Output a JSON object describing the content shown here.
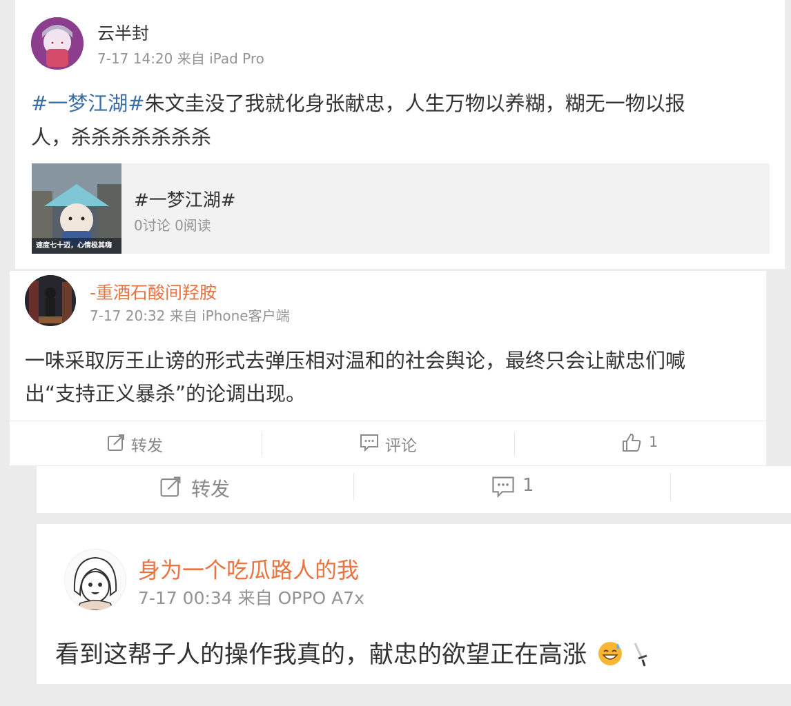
{
  "post1": {
    "username": "云半封",
    "meta": "7-17 14:20 来自 iPad Pro",
    "hashtag": "#一梦江湖#",
    "text_line1_rest": "朱文圭没了我就化身张献忠，人生万物以养糊，糊无一物以报",
    "text_line2": "人，杀杀杀杀杀杀杀",
    "topic_card": {
      "title": "#一梦江湖#",
      "stats": "0讨论 0阅读",
      "thumb_caption": "速度七十迈，心情极其嗨"
    }
  },
  "post2": {
    "username": "-重酒石酸间羟胺",
    "meta": "7-17 20:32 来自 iPhone客户端",
    "text_line1": "一味采取厉王止谤的形式去弹压相对温和的社会舆论，最终只会让献忠们喊",
    "text_line2": "出“支持正义暴杀”的论调出现。",
    "actions": {
      "repost": "转发",
      "comment": "评论",
      "like_count": "1"
    }
  },
  "action_bar2": {
    "repost": "转发",
    "comment_count": "1"
  },
  "post3": {
    "username": "身为一个吃瓜路人的我",
    "meta": "7-17 00:34 来自 OPPO A7x",
    "text": "看到这帮子人的操作我真的，献忠的欲望正在高涨"
  },
  "colors": {
    "hashtag_blue": "#3a6ea5",
    "username_orange": "#eb7340",
    "meta_gray": "#939393",
    "background": "#ececec"
  },
  "icons": [
    "repost-icon",
    "comment-icon",
    "like-icon",
    "grin-sweat-emoji",
    "dagger-emoji"
  ]
}
